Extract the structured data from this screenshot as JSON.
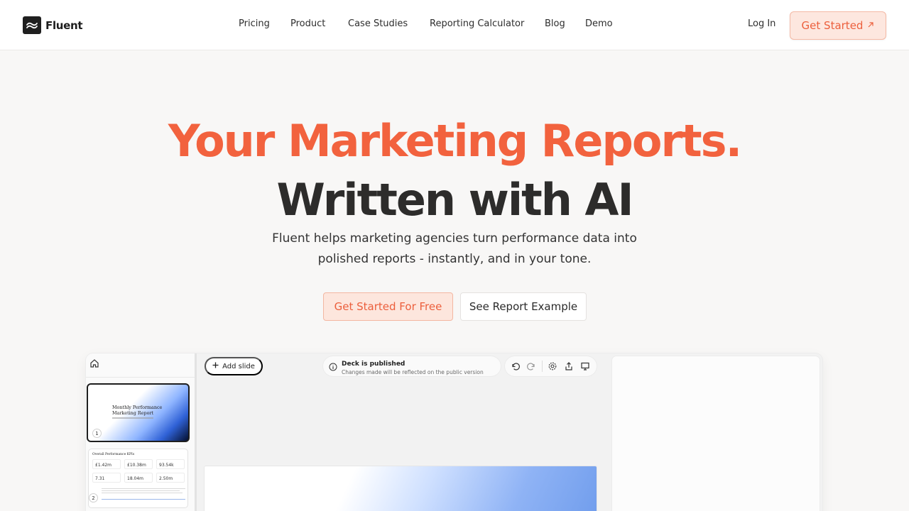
{
  "brand": {
    "name": "Fluent"
  },
  "nav": {
    "links": [
      "Pricing",
      "Product",
      "Case Studies",
      "Reporting Calculator",
      "Blog",
      "Demo"
    ],
    "login": "Log In",
    "cta": "Get Started",
    "cta_icon": "arrow-up-right-icon"
  },
  "hero": {
    "title_line1": "Your Marketing Reports.",
    "title_line2": "Written with AI",
    "subtitle_line1": "Fluent helps marketing agencies turn performance data into",
    "subtitle_line2": "polished reports - instantly, and in your tone.",
    "primary_button": "Get Started For Free",
    "secondary_button": "See Report Example"
  },
  "preview": {
    "add_slide": "Add slide",
    "publish_title": "Deck is published",
    "publish_subtitle": "Changes made will be reflected on the public version",
    "slides": [
      {
        "number": "1",
        "title_line1": "Monthly Performance",
        "title_line2": "Marketing Report"
      },
      {
        "number": "2",
        "title": "Overall Performance KPIs",
        "kpis": [
          "£1.42m",
          "£10.38m",
          "93.54k",
          "7.31",
          "18.04m",
          "2.50m"
        ]
      }
    ],
    "tools": [
      "undo-icon",
      "redo-icon",
      "settings-icon",
      "share-icon",
      "present-icon"
    ]
  },
  "colors": {
    "accent": "#f2623e",
    "accent_bg": "#fde6dd",
    "page_bg": "#f8f7f6",
    "text_dark": "#2d2c2b"
  }
}
